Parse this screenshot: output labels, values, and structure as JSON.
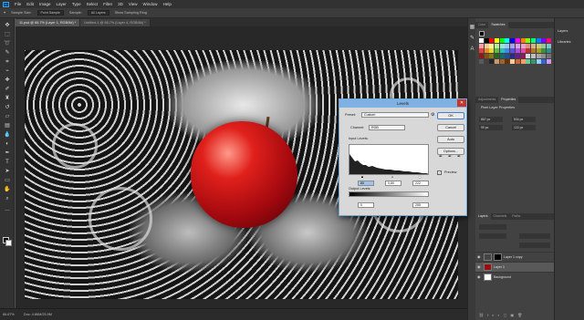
{
  "app": {
    "logo": "Ps",
    "menu": [
      "File",
      "Edit",
      "Image",
      "Layer",
      "Type",
      "Select",
      "Filter",
      "3D",
      "View",
      "Window",
      "Help"
    ]
  },
  "options_bar": {
    "tool": "Sample Size:",
    "sample_size": "Point Sample",
    "sample": "Sample:",
    "sample_value": "All Layers",
    "show_ring": "Show Sampling Ring"
  },
  "doc_tabs": [
    {
      "label": "11.psd @ 66.7% (Layer 1, RGB/8#) *",
      "active": true
    },
    {
      "label": "Untitled-1 @ 66.7% (Layer 4, RGB/8#) *",
      "active": false
    }
  ],
  "status": {
    "zoom": "66.67%",
    "doc": "Doc: 4.86M/25.9M"
  },
  "right_panels": {
    "top_tabs": [
      "Color",
      "Swatches"
    ],
    "far_labels": [
      "Layers",
      "Libraries"
    ],
    "adjust_tabs": [
      "Adjustments",
      "Properties"
    ],
    "properties_title": "Pixel Layer Properties",
    "props": {
      "w": "867 px",
      "h": "534 px",
      "x": "99 px",
      "y": "122 px",
      "go_label": "GO"
    },
    "layer_tabs": [
      "Layers",
      "Channels",
      "Paths"
    ],
    "layers": [
      {
        "name": "Layer 1 copy",
        "selected": false
      },
      {
        "name": "Layer 1",
        "selected": true
      },
      {
        "name": "Background",
        "selected": false
      }
    ],
    "swatch_colors": [
      "#ffffff",
      "#000000",
      "#ff0000",
      "#ffff00",
      "#00ff00",
      "#00ffff",
      "#0000ff",
      "#ff00ff",
      "#ff7f00",
      "#7fff00",
      "#00ff7f",
      "#007fff",
      "#7f00ff",
      "#ff007f",
      "#f2a3a3",
      "#f7c89c",
      "#fbf39a",
      "#bde6a0",
      "#9ce3d2",
      "#9fc6ee",
      "#a9a3e5",
      "#d7a2e3",
      "#e9a2c7",
      "#e08a8a",
      "#d4b28a",
      "#c9c97e",
      "#93c793",
      "#7ec6c6",
      "#e04040",
      "#e88a2e",
      "#e8d52e",
      "#5fbd3e",
      "#2ebdb0",
      "#3d8ae0",
      "#5a4de0",
      "#b04de0",
      "#e04da3",
      "#c03030",
      "#b57820",
      "#a8a020",
      "#3e8e3e",
      "#2e8e8e",
      "#901818",
      "#8a5010",
      "#807a10",
      "#246624",
      "#186868",
      "#1d4f9a",
      "#2a2a8e",
      "#6a1a8e",
      "#8e1a5e",
      "#d9d9d9",
      "#bfbfbf",
      "#a6a6a6",
      "#8c8c8c",
      "#737373",
      "#595959",
      "#404040",
      "#262626",
      "#cc9966",
      "#996633",
      "#663300",
      "#ffcc99",
      "#cc6633",
      "#ff9966",
      "#66cc99",
      "#339966",
      "#99ccff",
      "#3366cc",
      "#cc99ff"
    ]
  },
  "levels": {
    "title": "Levels",
    "preset_label": "Preset:",
    "preset_value": "Custom",
    "channel_label": "Channel:",
    "channel_value": "RGB",
    "input_label": "Input Levels:",
    "input_black": "85",
    "input_gamma": "0,80",
    "input_white": "222",
    "output_label": "Output Levels:",
    "output_black": "0",
    "output_white": "255",
    "buttons": {
      "ok": "OK",
      "cancel": "Cancel",
      "auto": "Auto",
      "options": "Options..."
    },
    "preview_label": "Preview",
    "preview_checked": true
  }
}
